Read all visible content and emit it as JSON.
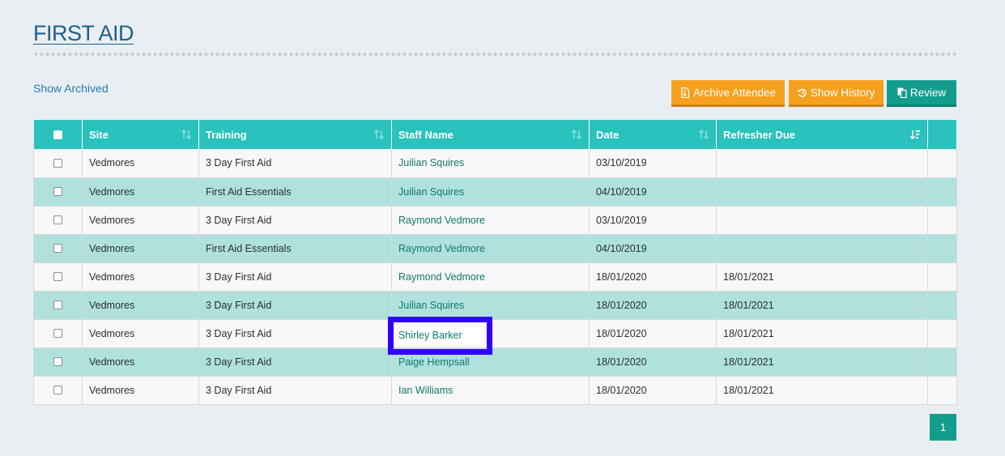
{
  "page": {
    "title": "FIRST AID"
  },
  "toolbar": {
    "show_archived": "Show Archived",
    "archive_attendee": "Archive Attendee",
    "show_history": "Show History",
    "review": "Review"
  },
  "table": {
    "headers": [
      "Site",
      "Training",
      "Staff Name",
      "Date",
      "Refresher Due"
    ],
    "rows": [
      {
        "site": "Vedmores",
        "training": "3 Day First Aid",
        "staff": "Juilian Squires",
        "date": "03/10/2019",
        "refresher": ""
      },
      {
        "site": "Vedmores",
        "training": "First Aid Essentials",
        "staff": "Juilian Squires",
        "date": "04/10/2019",
        "refresher": ""
      },
      {
        "site": "Vedmores",
        "training": "3 Day First Aid",
        "staff": "Raymond Vedmore",
        "date": "03/10/2019",
        "refresher": ""
      },
      {
        "site": "Vedmores",
        "training": "First Aid Essentials",
        "staff": "Raymond Vedmore",
        "date": "04/10/2019",
        "refresher": ""
      },
      {
        "site": "Vedmores",
        "training": "3 Day First Aid",
        "staff": "Raymond Vedmore",
        "date": "18/01/2020",
        "refresher": "18/01/2021"
      },
      {
        "site": "Vedmores",
        "training": "3 Day First Aid",
        "staff": "Juilian Squires",
        "date": "18/01/2020",
        "refresher": "18/01/2021"
      },
      {
        "site": "Vedmores",
        "training": "3 Day First Aid",
        "staff": "Shirley Barker",
        "date": "18/01/2020",
        "refresher": "18/01/2021"
      },
      {
        "site": "Vedmores",
        "training": "3 Day First Aid",
        "staff": "Paige Hempsall",
        "date": "18/01/2020",
        "refresher": "18/01/2021"
      },
      {
        "site": "Vedmores",
        "training": "3 Day First Aid",
        "staff": "Ian Williams",
        "date": "18/01/2020",
        "refresher": "18/01/2021"
      }
    ]
  },
  "pagination": {
    "current": "1"
  },
  "colors": {
    "header": "#29c2bc",
    "row_alt": "#b0e1dd",
    "orange": "#f5a01e",
    "teal": "#139d8c",
    "highlight": "#3300ff"
  },
  "icons": {
    "archive": "archive-doc-icon",
    "history": "history-icon",
    "review": "review-copy-icon",
    "sort": "sort-arrows-icon"
  }
}
